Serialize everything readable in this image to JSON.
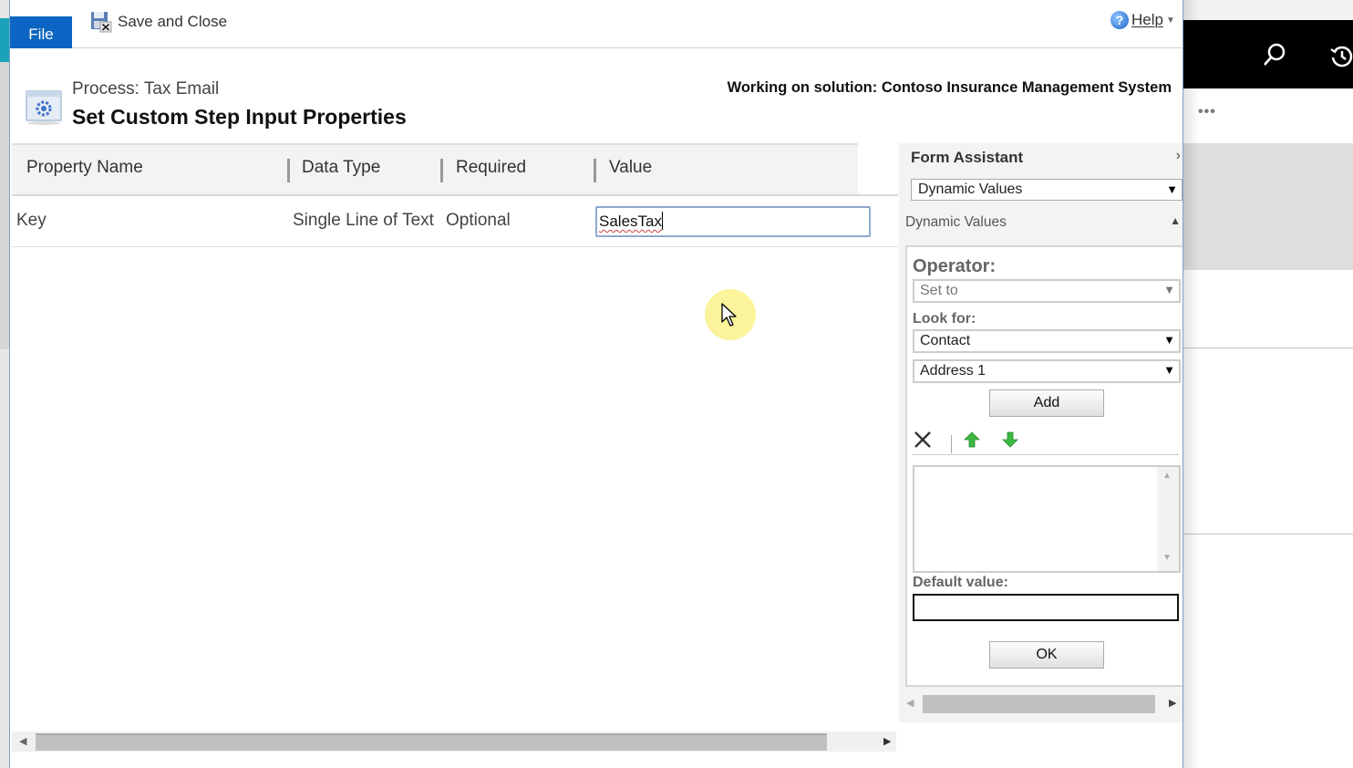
{
  "ribbon": {
    "file_tab": "File",
    "save_close_label": "Save and Close",
    "help_label": "Help"
  },
  "header": {
    "process_name": "Process: Tax Email",
    "page_title": "Set Custom Step Input Properties",
    "solution_label": "Working on solution: Contoso Insurance Management System"
  },
  "grid": {
    "columns": [
      "Property Name",
      "Data Type",
      "Required",
      "Value"
    ],
    "rows": [
      {
        "property_name": "Key",
        "data_type": "Single Line of Text",
        "required": "Optional",
        "value": "SalesTax"
      }
    ]
  },
  "form_assistant": {
    "title": "Form Assistant",
    "mode_select": "Dynamic Values",
    "section_title": "Dynamic Values",
    "operator_label": "Operator:",
    "operator_value": "Set to",
    "look_for_label": "Look for:",
    "look_for_entity": "Contact",
    "look_for_field": "Address 1",
    "add_button": "Add",
    "default_value_label": "Default value:",
    "default_value": "",
    "ok_button": "OK"
  },
  "background_app": {
    "more_label": "•••"
  }
}
